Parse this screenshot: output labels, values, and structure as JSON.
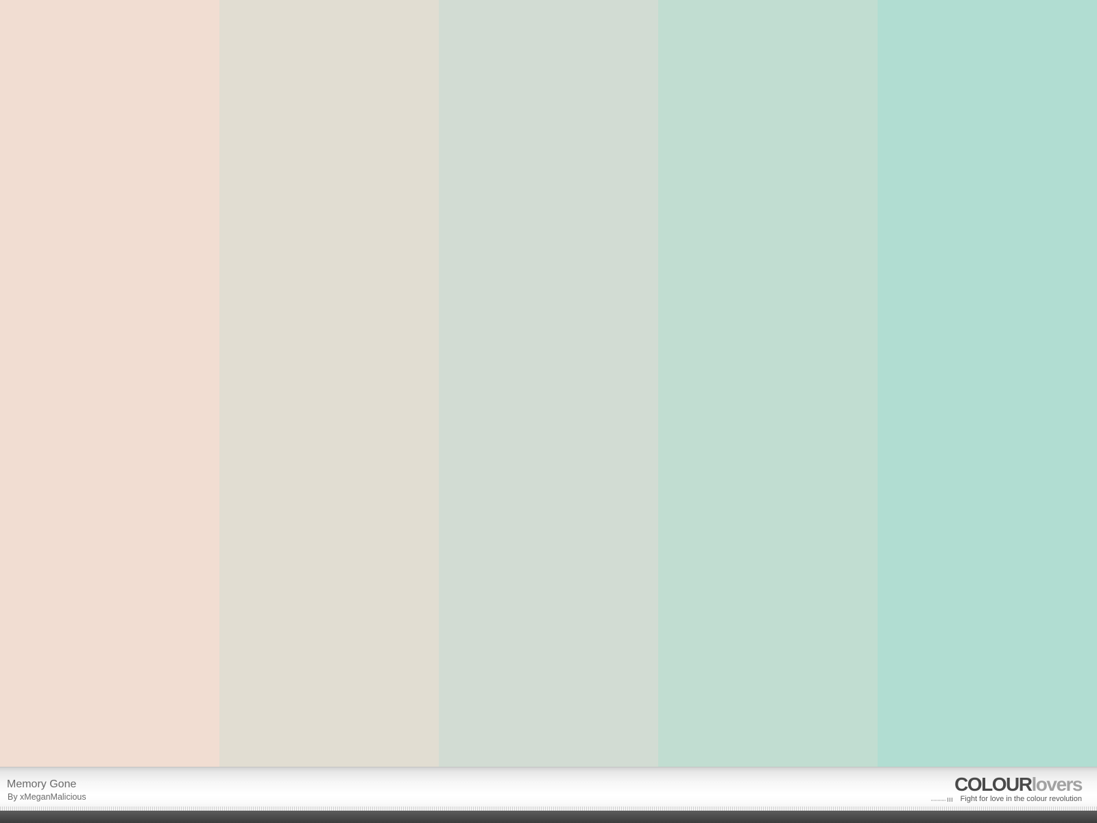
{
  "palette": {
    "title": "Memory Gone",
    "author": "By xMeganMalicious",
    "swatches": [
      {
        "color": "#F1DDD2"
      },
      {
        "color": "#E1DDD2"
      },
      {
        "color": "#D2DCD3"
      },
      {
        "color": "#C1DDD1"
      },
      {
        "color": "#B1DDD2"
      }
    ]
  },
  "brand": {
    "logo_bold": "COLOUR",
    "logo_light": "lovers",
    "tagline": "Fight for love in the colour revolution"
  }
}
